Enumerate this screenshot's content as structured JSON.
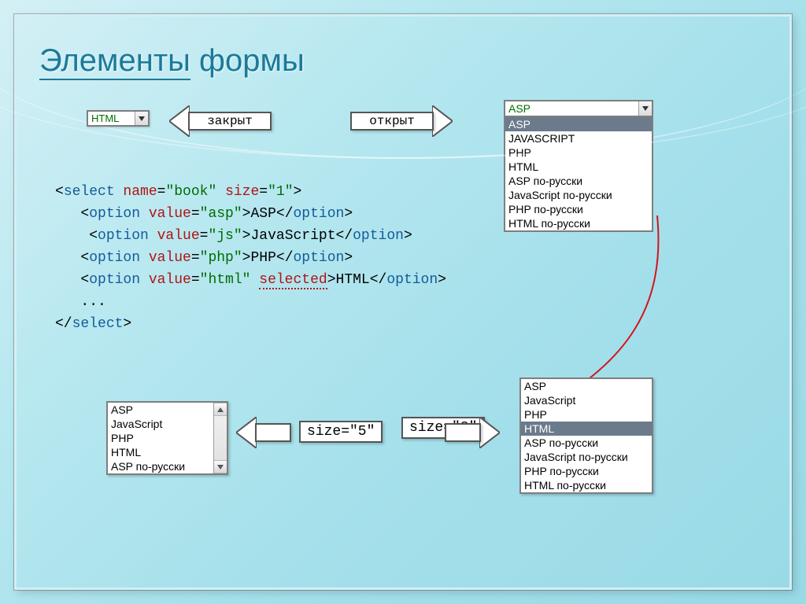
{
  "title_word1": "Элементы",
  "title_word2": "формы",
  "arrow_closed_label": "закрыт",
  "arrow_open_label": "открыт",
  "closed_select_value": "HTML",
  "open_select_value": "ASP",
  "open_select_options": [
    "ASP",
    "JAVASCRIPT",
    "PHP",
    "HTML",
    "ASP по-русски",
    "JavaScript по-русски",
    "PHP по-русски",
    "HTML по-русски"
  ],
  "code": {
    "l1a": "<",
    "l1b": "select",
    "l1c": " name",
    "l1d": "=",
    "l1e": "\"book\"",
    "l1f": " size",
    "l1g": "=",
    "l1h": "\"1\"",
    "l1i": ">",
    "l2a": "   <",
    "l2b": "option",
    "l2c": " value",
    "l2d": "=",
    "l2e": "\"asp\"",
    "l2f": ">",
    "l2g": "ASP",
    "l2h": "</",
    "l2i": "option",
    "l2j": ">",
    "l3a": "    <",
    "l3b": "option",
    "l3c": " value",
    "l3d": "=",
    "l3e": "\"js\"",
    "l3f": ">",
    "l3g": "JavaScript",
    "l3h": "</",
    "l3i": "option",
    "l3j": ">",
    "l4a": "   <",
    "l4b": "option",
    "l4c": " value",
    "l4d": "=",
    "l4e": "\"php\"",
    "l4f": ">",
    "l4g": "PHP",
    "l4h": "</",
    "l4i": "option",
    "l4j": ">",
    "l5a": "   <",
    "l5b": "option",
    "l5c": " value",
    "l5d": "=",
    "l5e": "\"html\"",
    "l5f": " ",
    "l5g": "selected",
    "l5h": ">",
    "l5i": "HTML",
    "l5j": "</",
    "l5k": "option",
    "l5l": ">",
    "l6": "   ...",
    "l7a": "</",
    "l7b": "select",
    "l7c": ">"
  },
  "listbox5_options": [
    "ASP",
    "JavaScript",
    "PHP",
    "HTML",
    "ASP по-русски"
  ],
  "listbox8_options": [
    "ASP",
    "JavaScript",
    "PHP",
    "HTML",
    "ASP по-русски",
    "JavaScript по-русски",
    "PHP по-русски",
    "HTML по-русски"
  ],
  "listbox8_selected_index": 3,
  "size5_label": "size=\"5\"",
  "size8_label": "size=\"8\""
}
